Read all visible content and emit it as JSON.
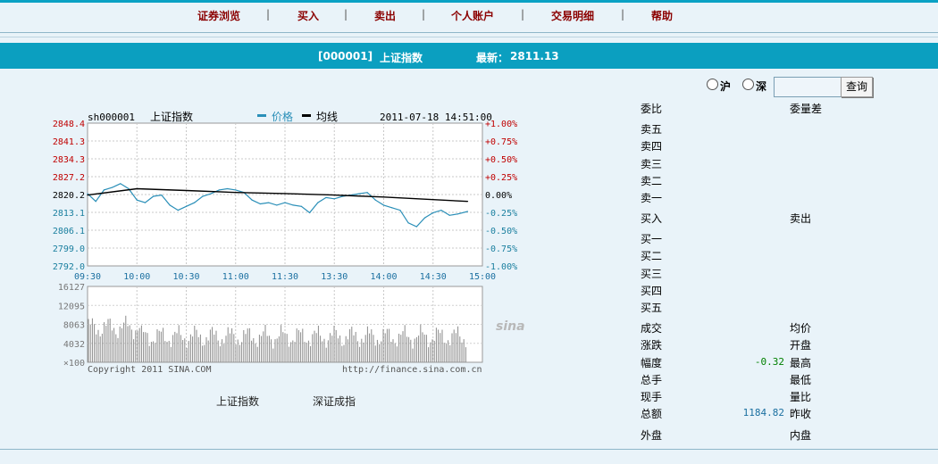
{
  "nav": {
    "items": [
      "证券浏览",
      "买入",
      "卖出",
      "个人账户",
      "交易明细",
      "帮助"
    ],
    "separator": "|"
  },
  "banner": {
    "code": "[000001]",
    "name": "上证指数",
    "latest_label": "最新：",
    "latest_value": "2811.13"
  },
  "search": {
    "sh_label": "沪",
    "sz_label": "深",
    "input_value": "",
    "button": "查询"
  },
  "chart_header": {
    "symbol": "sh000001",
    "name": "上证指数",
    "legend_price": "价格",
    "legend_avg": "均线",
    "datetime": "2011-07-18 14:51:00"
  },
  "chart_data": {
    "type": "line",
    "title": "上证指数",
    "price_ticks": [
      "2848.4",
      "2841.3",
      "2834.3",
      "2827.2",
      "2820.2",
      "2813.1",
      "2806.1",
      "2799.0",
      "2792.0"
    ],
    "pct_ticks": [
      "+1.00%",
      "+0.75%",
      "+0.50%",
      "+0.25%",
      "0.00%",
      "-0.25%",
      "-0.50%",
      "-0.75%",
      "-1.00%"
    ],
    "time_ticks": [
      "09:30",
      "10:00",
      "10:30",
      "11:00",
      "11:30",
      "13:30",
      "14:00",
      "14:30",
      "15:00"
    ],
    "ylim": [
      2792.0,
      2848.4
    ],
    "series": [
      {
        "name": "价格",
        "x": [
          "09:30",
          "09:35",
          "09:40",
          "09:45",
          "09:50",
          "09:55",
          "10:00",
          "10:05",
          "10:10",
          "10:15",
          "10:20",
          "10:25",
          "10:30",
          "10:35",
          "10:40",
          "10:45",
          "10:50",
          "10:55",
          "11:00",
          "11:05",
          "11:10",
          "11:15",
          "11:20",
          "11:25",
          "11:30",
          "13:05",
          "13:10",
          "13:15",
          "13:20",
          "13:25",
          "13:30",
          "13:35",
          "13:40",
          "13:45",
          "13:50",
          "13:55",
          "14:00",
          "14:05",
          "14:10",
          "14:15",
          "14:20",
          "14:25",
          "14:30",
          "14:35",
          "14:40",
          "14:45",
          "14:51"
        ],
        "values": [
          2820.5,
          2817.5,
          2822.0,
          2823.0,
          2824.5,
          2822.5,
          2818.0,
          2817.0,
          2819.5,
          2820.0,
          2816.0,
          2814.0,
          2815.5,
          2817.0,
          2819.5,
          2820.5,
          2822.0,
          2822.5,
          2822.0,
          2821.0,
          2818.0,
          2816.5,
          2817.0,
          2816.0,
          2817.0,
          2816.0,
          2815.5,
          2813.0,
          2817.0,
          2819.0,
          2818.5,
          2819.5,
          2820.0,
          2820.5,
          2821.0,
          2818.0,
          2816.0,
          2815.0,
          2814.0,
          2809.0,
          2807.5,
          2811.0,
          2813.0,
          2814.0,
          2812.0,
          2812.5,
          2813.5
        ]
      },
      {
        "name": "均线",
        "x": [
          "09:30",
          "10:00",
          "10:30",
          "11:00",
          "11:30",
          "13:30",
          "14:00",
          "14:30",
          "14:51"
        ],
        "values": [
          2820.0,
          2822.5,
          2821.8,
          2821.0,
          2820.6,
          2820.0,
          2819.2,
          2818.2,
          2817.5
        ]
      }
    ],
    "volume_ticks": [
      "16127",
      "12095",
      "8063",
      "4032",
      "×100"
    ],
    "volume_note": "volume bars shown below price chart, roughly 4000–8000 ×100 per bar"
  },
  "chart_footer": {
    "copyright": "Copyright 2011 SINA.COM",
    "url": "http://finance.sina.com.cn",
    "logo": "sina"
  },
  "links": [
    "上证指数",
    "深证成指"
  ],
  "orderbook": {
    "ratio_label": "委比",
    "diff_label": "委量差",
    "sell": [
      "卖五",
      "卖四",
      "卖三",
      "卖二",
      "卖一"
    ],
    "buy_in": "买入",
    "sell_out": "卖出",
    "buy": [
      "买一",
      "买二",
      "买三",
      "买四",
      "买五"
    ],
    "stats_left": [
      "成交",
      "涨跌",
      "幅度",
      "总手",
      "现手",
      "总额"
    ],
    "stats_right": [
      "均价",
      "开盘",
      "最高",
      "最低",
      "量比",
      "昨收"
    ],
    "amplitude_value": "-0.32",
    "amount_value": "1184.82",
    "outer": "外盘",
    "inner": "内盘",
    "colors": {
      "down": "#008000",
      "up": "#cc0000"
    }
  }
}
